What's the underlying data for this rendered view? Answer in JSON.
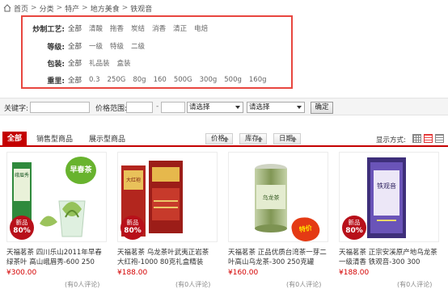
{
  "breadcrumb": {
    "items": [
      "首页",
      "分类",
      "特产",
      "地方美食",
      "铁观音"
    ],
    "separator": ">"
  },
  "filters": [
    {
      "label": "炒制工艺:",
      "options": [
        "全部",
        "清酸",
        "拖香",
        "炭结",
        "消香",
        "清正",
        "电焙"
      ]
    },
    {
      "label": "等级:",
      "options": [
        "全部",
        "一级",
        "特级",
        "二级"
      ]
    },
    {
      "label": "包装:",
      "options": [
        "全部",
        "礼品装",
        "盒装"
      ]
    },
    {
      "label": "重里:",
      "options": [
        "全部",
        "0.3",
        "250G",
        "80g",
        "160",
        "500G",
        "300g",
        "500g",
        "160g"
      ]
    }
  ],
  "search": {
    "keyword_label": "关键字:",
    "keyword_value": "",
    "price_label": "价格范围:",
    "price_min": "",
    "price_dash": "-",
    "price_max": "",
    "select1": "请选择",
    "select2": "请选择",
    "confirm": "确定"
  },
  "tabs": {
    "all": "全部",
    "items": [
      "销售型商品",
      "展示型商品"
    ]
  },
  "sort": [
    "价格",
    "库存",
    "日期"
  ],
  "display_label": "显示方式:",
  "products": [
    {
      "name": "天福茗茶 四川乐山2011年早春绿茶叶 高山峨眉秀-600 250",
      "price": "¥300.00",
      "reviews": "(有0人评论)",
      "badge_new": "新品",
      "badge_pct": "80%",
      "tag": "早春茶",
      "box_text": "峨眉秀"
    },
    {
      "name": "天福茗茶 乌龙茶叶武夷正岩茶 大红袍-1000 80克礼盒精装",
      "price": "¥188.00",
      "reviews": "(有0人评论)",
      "badge_new": "新品",
      "badge_pct": "80%",
      "box_text": "大红袍"
    },
    {
      "name": "天福茗茶 正品优质台湾茶一芽二叶高山乌龙茶-300 250克罐",
      "price": "¥160.00",
      "reviews": "(有0人评论)",
      "tag": "特价",
      "box_text": "乌龙茶"
    },
    {
      "name": "天福茗茶 正宗安溪原产地乌龙茶一级清香 铁观音-300 300",
      "price": "¥188.00",
      "reviews": "(有0人评论)",
      "badge_new": "新品",
      "badge_pct": "80%",
      "box_text": "铁观音"
    }
  ],
  "colors": {
    "accent": "#c40000",
    "filter_border": "#e8463f",
    "price": "#d40000"
  }
}
